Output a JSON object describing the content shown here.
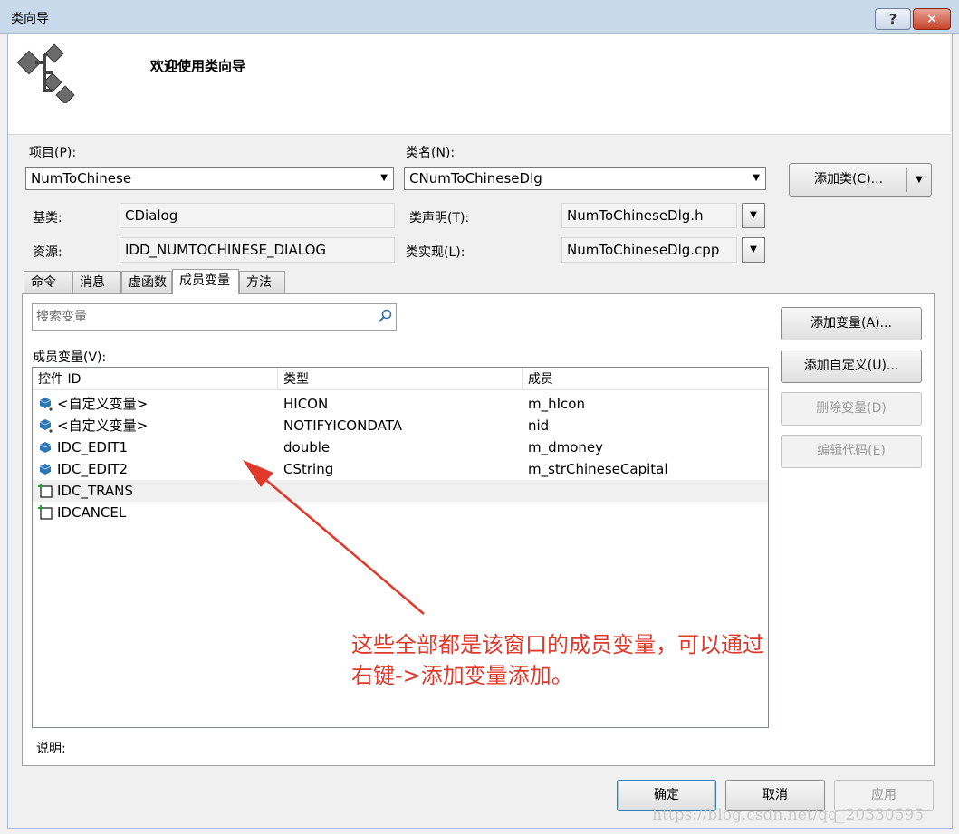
{
  "window": {
    "title": "类向导",
    "help_glyph": "?",
    "close_glyph": "✕"
  },
  "banner": {
    "title": "欢迎使用类向导",
    "icon": "class-wizard-icon"
  },
  "project": {
    "label": "项目(P):",
    "value": "NumToChinese"
  },
  "classname": {
    "label": "类名(N):",
    "value": "CNumToChineseDlg"
  },
  "add_class_button": {
    "label": "添加类(C)..."
  },
  "base_class": {
    "label": "基类:",
    "value": "CDialog"
  },
  "resource": {
    "label": "资源:",
    "value": "IDD_NUMTOCHINESE_DIALOG"
  },
  "class_declaration": {
    "label": "类声明(T):",
    "value": "NumToChineseDlg.h"
  },
  "class_implementation": {
    "label": "类实现(L):",
    "value": "NumToChineseDlg.cpp"
  },
  "tabs": [
    {
      "label": "命令",
      "active": false
    },
    {
      "label": "消息",
      "active": false
    },
    {
      "label": "虚函数",
      "active": false
    },
    {
      "label": "成员变量",
      "active": true
    },
    {
      "label": "方法",
      "active": false
    }
  ],
  "search": {
    "placeholder": "搜索变量",
    "icon": "search-icon"
  },
  "member_vars_label": "成员变量(V):",
  "table": {
    "columns": [
      "控件 ID",
      "类型",
      "成员"
    ],
    "rows": [
      {
        "id": "<自定义变量>",
        "type": "HICON",
        "member": "m_hIcon",
        "icon": "custom-variable-icon"
      },
      {
        "id": "<自定义变量>",
        "type": "NOTIFYICONDATA",
        "member": "nid",
        "icon": "custom-variable-icon"
      },
      {
        "id": "IDC_EDIT1",
        "type": "double",
        "member": "m_dmoney",
        "icon": "variable-icon"
      },
      {
        "id": "IDC_EDIT2",
        "type": "CString",
        "member": "m_strChineseCapital",
        "icon": "variable-icon"
      },
      {
        "id": "IDC_TRANS",
        "type": "",
        "member": "",
        "icon": "control-icon"
      },
      {
        "id": "IDCANCEL",
        "type": "",
        "member": "",
        "icon": "control-icon"
      }
    ]
  },
  "side_buttons": {
    "add_variable": "添加变量(A)...",
    "add_custom": "添加自定义(U)...",
    "delete_variable": "删除变量(D)",
    "edit_code": "编辑代码(E)"
  },
  "description_label": "说明:",
  "footer": {
    "ok": "确定",
    "cancel": "取消",
    "apply": "应用"
  },
  "annotation": {
    "line1": "这些全部都是该窗口的成员变量，可以通过",
    "line2": "右键->添加变量添加。",
    "color": "#e0392b"
  },
  "watermark": "https://blog.csdn.net/qq_20330595"
}
